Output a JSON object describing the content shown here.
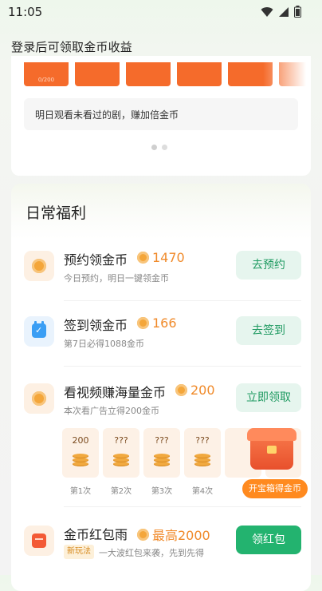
{
  "status_bar": {
    "time": "11:05"
  },
  "login_banner": {
    "text": "登录后可领取金币收益"
  },
  "top_card": {
    "tile_caption": "0/200",
    "tip": "明日观看未看过的剧，赚加倍金币"
  },
  "daily": {
    "title": "日常福利",
    "tasks": [
      {
        "name": "预约领金币",
        "reward": "1470",
        "sub": "今日预约，明日一键领金币",
        "button": "去预约"
      },
      {
        "name": "签到领金币",
        "reward": "166",
        "sub": "第7日必得1088金币",
        "button": "去签到"
      },
      {
        "name": "看视频赚海量金币",
        "reward": "200",
        "sub": "本次看广告立得200金币",
        "button": "立即领取"
      },
      {
        "name": "金币红包雨",
        "reward": "最高2000",
        "tag": "新玩法",
        "sub": "一大波红包来袭，先到先得",
        "button": "领红包"
      }
    ],
    "video_tiles": [
      {
        "amount": "200",
        "label": "第1次"
      },
      {
        "amount": "???",
        "label": "第2次"
      },
      {
        "amount": "???",
        "label": "第3次"
      },
      {
        "amount": "???",
        "label": "第4次"
      }
    ],
    "chest_button": "开宝箱得金币"
  }
}
